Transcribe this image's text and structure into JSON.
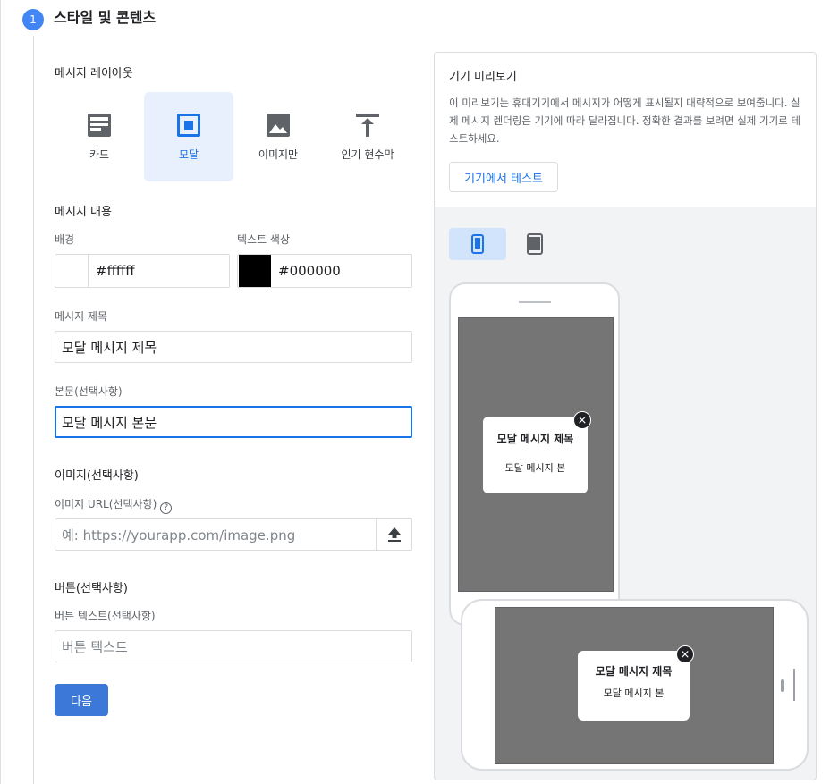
{
  "step": {
    "number": "1",
    "title": "스타일 및 콘텐츠"
  },
  "layout": {
    "label": "메시지 레이아웃",
    "options": [
      {
        "label": "카드",
        "icon": "card-icon",
        "selected": false
      },
      {
        "label": "모달",
        "icon": "modal-icon",
        "selected": true
      },
      {
        "label": "이미지만",
        "icon": "image-icon",
        "selected": false
      },
      {
        "label": "인기 현수막",
        "icon": "banner-icon",
        "selected": false
      }
    ]
  },
  "content": {
    "label": "메시지 내용",
    "background": {
      "label": "배경",
      "value": "#ffffff"
    },
    "text_color": {
      "label": "텍스트 색상",
      "value": "#000000"
    },
    "title": {
      "label": "메시지 제목",
      "value": "모달 메시지 제목"
    },
    "body": {
      "label": "본문(선택사항)",
      "value": "모달 메시지 본문"
    }
  },
  "image": {
    "label": "이미지(선택사항)",
    "url_label": "이미지 URL(선택사항)",
    "help": "?",
    "placeholder": "예: https://yourapp.com/image.png"
  },
  "button": {
    "label": "버튼(선택사항)",
    "text_label": "버튼 텍스트(선택사항)",
    "placeholder": "버튼 텍스트"
  },
  "next_label": "다음",
  "preview": {
    "title": "기기 미리보기",
    "description": "이 미리보기는 휴대기기에서 메시지가 어떻게 표시될지 대략적으로 보여줍니다. 실제 메시지 렌더링은 기기에 따라 달라집니다. 정확한 결과를 보려면 실제 기기로 테스트하세요.",
    "test_button": "기기에서 테스트",
    "modal_title": "모달 메시지 제목",
    "modal_body": "모달 메시지 본",
    "close": "×"
  },
  "colors": {
    "accent": "#1a73e8",
    "selected_bg": "#e8f0fe",
    "step": "#4285f4",
    "next_button": "#3c78d8"
  }
}
